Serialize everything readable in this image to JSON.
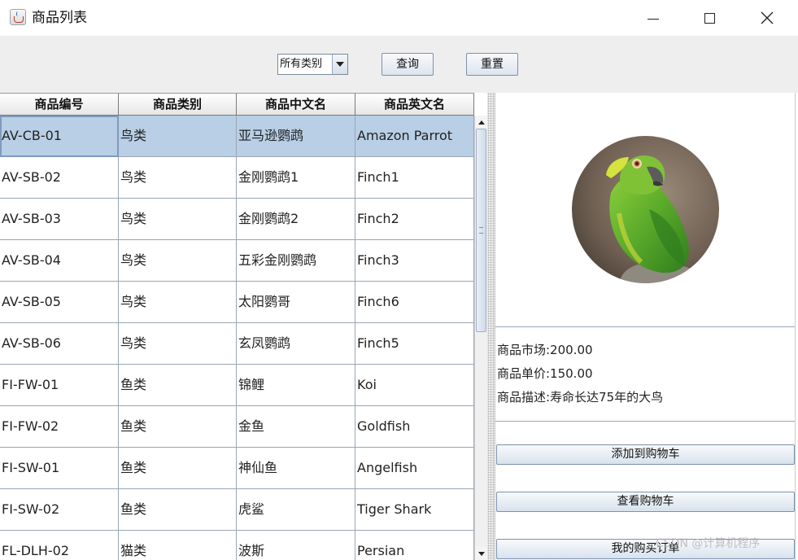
{
  "window": {
    "title": "商品列表",
    "app_icon": "java-cup-icon",
    "controls": [
      "minimize-icon",
      "maximize-icon",
      "close-icon"
    ]
  },
  "toolbar": {
    "category_select": {
      "selected": "所有类别"
    },
    "query_label": "查询",
    "reset_label": "重置"
  },
  "table": {
    "columns": [
      "商品编号",
      "商品类别",
      "商品中文名",
      "商品英文名"
    ],
    "selected_row": 0,
    "rows": [
      [
        "AV-CB-01",
        "鸟类",
        "亚马逊鹦鹉",
        "Amazon Parrot"
      ],
      [
        "AV-SB-02",
        "鸟类",
        "金刚鹦鹉1",
        "Finch1"
      ],
      [
        "AV-SB-03",
        "鸟类",
        "金刚鹦鹉2",
        "Finch2"
      ],
      [
        "AV-SB-04",
        "鸟类",
        "五彩金刚鹦鹉",
        "Finch3"
      ],
      [
        "AV-SB-05",
        "鸟类",
        "太阳鹦哥",
        "Finch6"
      ],
      [
        "AV-SB-06",
        "鸟类",
        "玄凤鹦鹉",
        "Finch5"
      ],
      [
        "FI-FW-01",
        "鱼类",
        "锦鲤",
        "Koi"
      ],
      [
        "FI-FW-02",
        "鱼类",
        "金鱼",
        "Goldfish"
      ],
      [
        "FI-SW-01",
        "鱼类",
        "神仙鱼",
        "Angelfish"
      ],
      [
        "FI-SW-02",
        "鱼类",
        "虎鲨",
        "Tiger Shark"
      ],
      [
        "FL-DLH-02",
        "猫类",
        "波斯",
        "Persian"
      ]
    ]
  },
  "detail": {
    "image": "parrot-photo",
    "market_price": "商品市场:200.00",
    "unit_price": "商品单价:150.00",
    "description": "商品描述:寿命长达75年的大鸟",
    "add_to_cart_label": "添加到购物车",
    "view_cart_label": "查看购物车",
    "my_orders_label": "我的购买订单"
  },
  "watermark": "CSDN @计算机程序",
  "colors": {
    "selected_row": "#b8cfe5",
    "toolbar_bg": "#eeeeee",
    "button_border": "#7d91ab"
  }
}
